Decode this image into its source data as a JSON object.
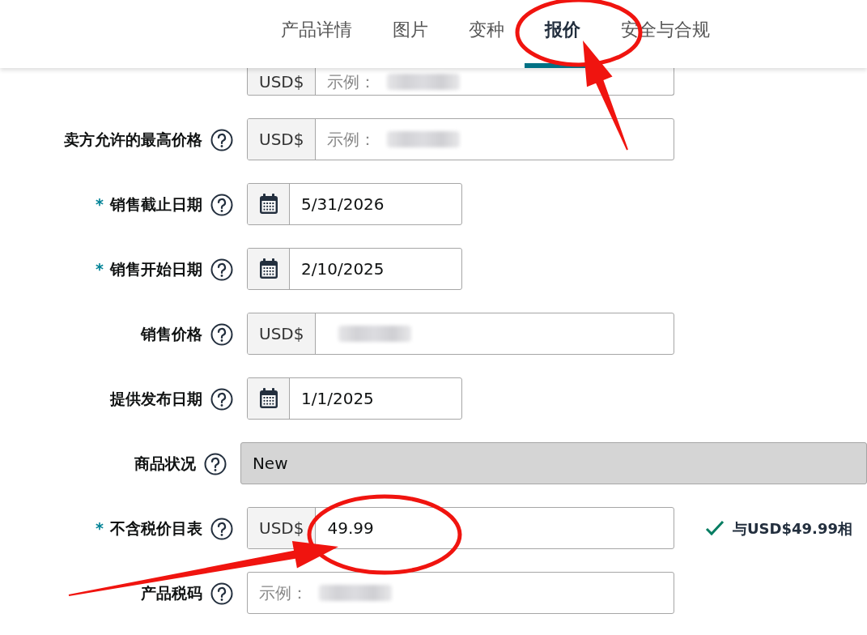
{
  "tabs": [
    {
      "label": "产品详情",
      "selected": false
    },
    {
      "label": "图片",
      "selected": false
    },
    {
      "label": "变种",
      "selected": false
    },
    {
      "label": "报价",
      "selected": true
    },
    {
      "label": "安全与合规",
      "selected": false
    }
  ],
  "fields": [
    {
      "kind": "currency",
      "prefix": "USD$",
      "placeholder": "示例：",
      "blurred": true,
      "disabled": false
    },
    {
      "kind": "currency",
      "label": "卖方允许的最高价格",
      "prefix": "USD$",
      "placeholder": "示例：",
      "blurred": true,
      "disabled": false
    },
    {
      "kind": "date",
      "marker": "*",
      "label": "销售截止日期",
      "value": "5/31/2026",
      "disabled": false
    },
    {
      "kind": "date",
      "marker": "*",
      "label": "销售开始日期",
      "value": "2/10/2025",
      "disabled": false
    },
    {
      "kind": "currency",
      "label": "销售价格",
      "prefix": "USD$",
      "blurred": true,
      "disabled": false
    },
    {
      "kind": "date",
      "label": "提供发布日期",
      "value": "1/1/2025",
      "disabled": false
    },
    {
      "kind": "select",
      "label": "商品状况",
      "value": "New",
      "disabled": true
    },
    {
      "kind": "currency",
      "marker": "*",
      "label": "不含税价目表",
      "prefix": "USD$",
      "value": "49.99",
      "message": "与USD$49.99相",
      "disabled": false
    },
    {
      "kind": "text",
      "label": "产品税码",
      "placeholder": "示例：",
      "blurred": true,
      "disabled": false
    }
  ],
  "annotations": [
    {
      "kind": "ellipse"
    },
    {
      "kind": "arrow"
    },
    {
      "kind": "ellipse"
    },
    {
      "kind": "arrow"
    }
  ]
}
